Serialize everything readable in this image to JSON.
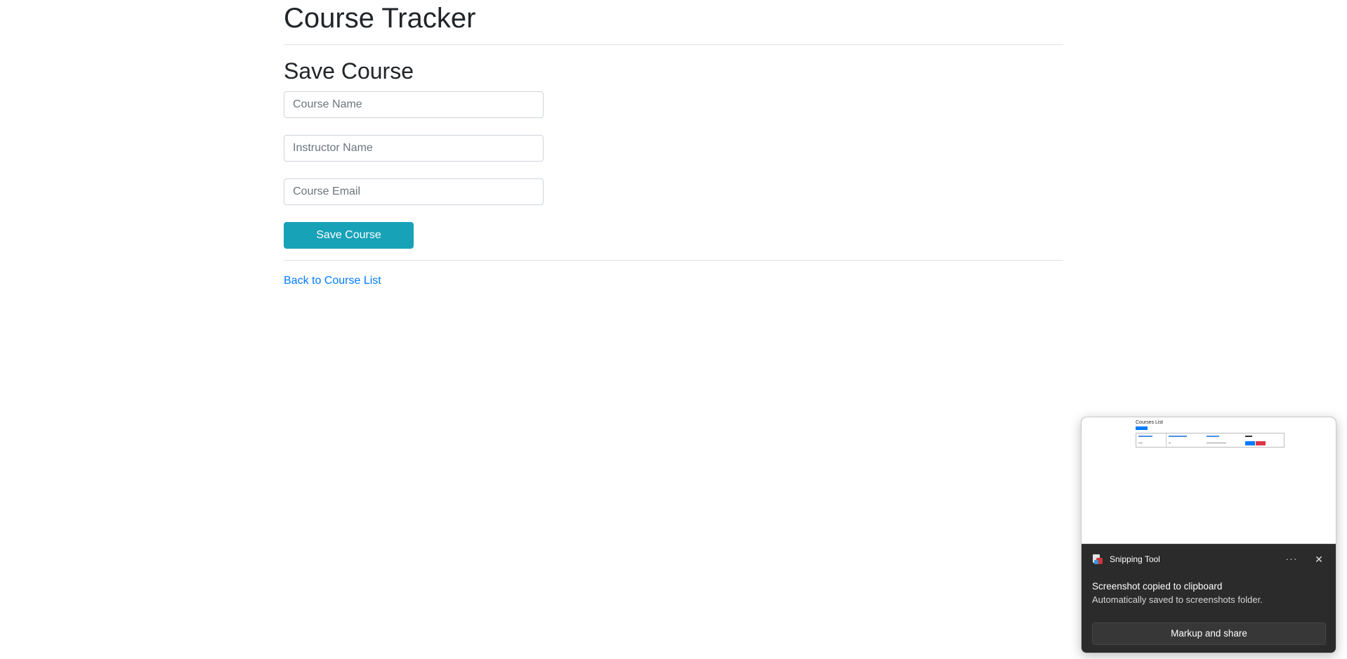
{
  "page": {
    "title": "Course Tracker",
    "section_title": "Save Course"
  },
  "form": {
    "course_name_placeholder": "Course Name",
    "instructor_name_placeholder": "Instructor Name",
    "course_email_placeholder": "Course Email",
    "course_name_value": "",
    "instructor_name_value": "",
    "course_email_value": "",
    "save_button_label": "Save Course",
    "save_button_color": "#17a2b8"
  },
  "links": {
    "back_label": "Back to Course List",
    "link_color": "#007bff"
  },
  "toast": {
    "app_name": "Snipping Tool",
    "more_icon": "···",
    "close_icon": "✕",
    "title": "Screenshot copied to clipboard",
    "message": "Automatically saved to screenshots folder.",
    "action_label": "Markup and share",
    "thumbnail_title": "Courses List"
  }
}
